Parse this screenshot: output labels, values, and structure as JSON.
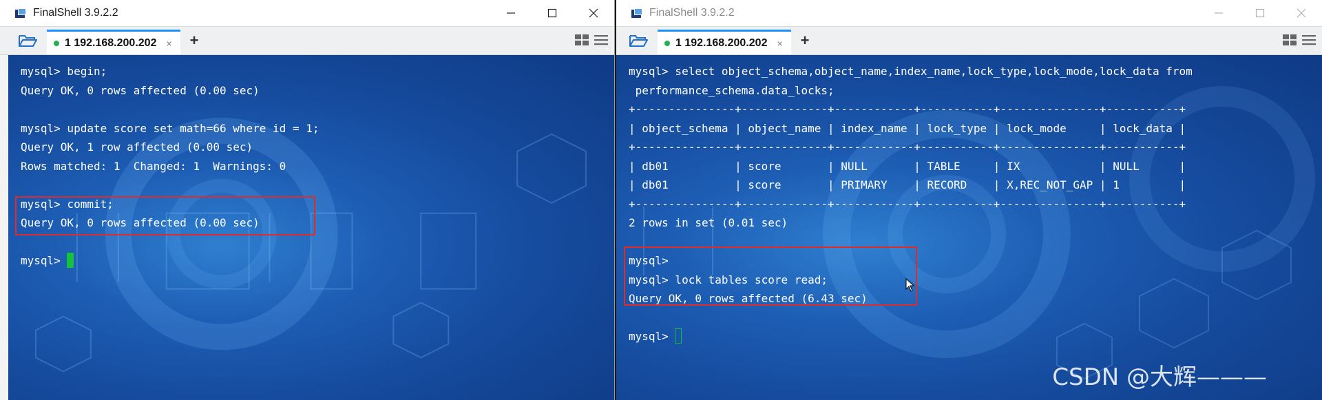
{
  "left": {
    "title": "FinalShell 3.9.2.2",
    "tab": {
      "label": "1 192.168.200.202",
      "close": "×"
    },
    "add_tab": "+",
    "lines": [
      "mysql> begin;",
      "Query OK, 0 rows affected (0.00 sec)",
      "",
      "mysql> update score set math=66 where id = 1;",
      "Query OK, 1 row affected (0.00 sec)",
      "Rows matched: 1  Changed: 1  Warnings: 0",
      "",
      "mysql> commit;",
      "Query OK, 0 rows affected (0.00 sec)",
      ""
    ],
    "prompt": "mysql> "
  },
  "right": {
    "title": "FinalShell 3.9.2.2",
    "tab": {
      "label": "1 192.168.200.202",
      "close": "×"
    },
    "add_tab": "+",
    "lines": [
      "mysql> select object_schema,object_name,index_name,lock_type,lock_mode,lock_data from",
      " performance_schema.data_locks;",
      "+---------------+-------------+------------+-----------+---------------+-----------+",
      "| object_schema | object_name | index_name | lock_type | lock_mode     | lock_data |",
      "+---------------+-------------+------------+-----------+---------------+-----------+",
      "| db01          | score       | NULL       | TABLE     | IX            | NULL      |",
      "| db01          | score       | PRIMARY    | RECORD    | X,REC_NOT_GAP | 1         |",
      "+---------------+-------------+------------+-----------+---------------+-----------+",
      "2 rows in set (0.01 sec)",
      "",
      "mysql>",
      "mysql> lock tables score read;",
      "Query OK, 0 rows affected (6.43 sec)",
      ""
    ],
    "prompt": "mysql> ",
    "watermark": "CSDN @大辉———"
  },
  "colors": {
    "terminal_bg": "#1d5db4",
    "highlight": "#e02b2b",
    "cursor": "#14c23c",
    "tab_accent": "#1e90ff",
    "status_dot": "#22b14c"
  },
  "icons": {
    "window_icon": "finalshell-app-icon",
    "folder": "folder-open-icon",
    "minimize": "minimize-icon",
    "maximize": "maximize-icon",
    "close": "close-icon",
    "layout": "grid-layout-icon",
    "menu": "menu-lines-icon"
  }
}
